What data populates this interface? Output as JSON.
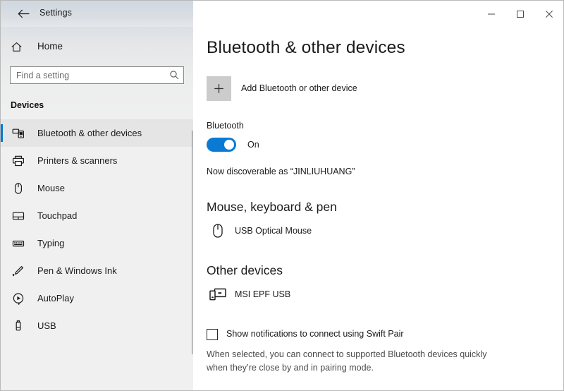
{
  "titlebar": {
    "back_icon": "back-arrow-icon",
    "app_title": "Settings",
    "minimize_icon": "minimize-icon",
    "maximize_icon": "maximize-icon",
    "close_icon": "close-icon"
  },
  "sidebar": {
    "home_label": "Home",
    "home_icon": "home-icon",
    "search": {
      "value": "",
      "placeholder": "Find a setting",
      "icon": "search-icon"
    },
    "group_title": "Devices",
    "items": [
      {
        "label": "Bluetooth & other devices",
        "icon": "bluetooth-devices-icon",
        "selected": true
      },
      {
        "label": "Printers & scanners",
        "icon": "printer-icon",
        "selected": false
      },
      {
        "label": "Mouse",
        "icon": "mouse-icon",
        "selected": false
      },
      {
        "label": "Touchpad",
        "icon": "touchpad-icon",
        "selected": false
      },
      {
        "label": "Typing",
        "icon": "keyboard-icon",
        "selected": false
      },
      {
        "label": "Pen & Windows Ink",
        "icon": "pen-icon",
        "selected": false
      },
      {
        "label": "AutoPlay",
        "icon": "autoplay-icon",
        "selected": false
      },
      {
        "label": "USB",
        "icon": "usb-icon",
        "selected": false
      }
    ]
  },
  "main": {
    "page_title": "Bluetooth & other devices",
    "add_device": {
      "icon": "plus-icon",
      "label": "Add Bluetooth or other device"
    },
    "bluetooth": {
      "label": "Bluetooth",
      "state": "On",
      "toggle_on": true,
      "discoverable": "Now discoverable as “JINLIUHUANG”"
    },
    "sections": [
      {
        "heading": "Mouse, keyboard & pen",
        "devices": [
          {
            "name": "USB Optical Mouse",
            "icon": "mouse-device-icon"
          }
        ]
      },
      {
        "heading": "Other devices",
        "devices": [
          {
            "name": "MSI EPF USB",
            "icon": "generic-device-icon"
          }
        ]
      }
    ],
    "swift_pair": {
      "checked": false,
      "label": "Show notifications to connect using Swift Pair",
      "description": "When selected, you can connect to supported Bluetooth devices quickly when they’re close by and in pairing mode."
    }
  },
  "colors": {
    "accent": "#0078d7",
    "toggle_on": "#0a7ad4",
    "sidebar_bg": "#f0f0f0",
    "add_button_bg": "#cccccc"
  }
}
